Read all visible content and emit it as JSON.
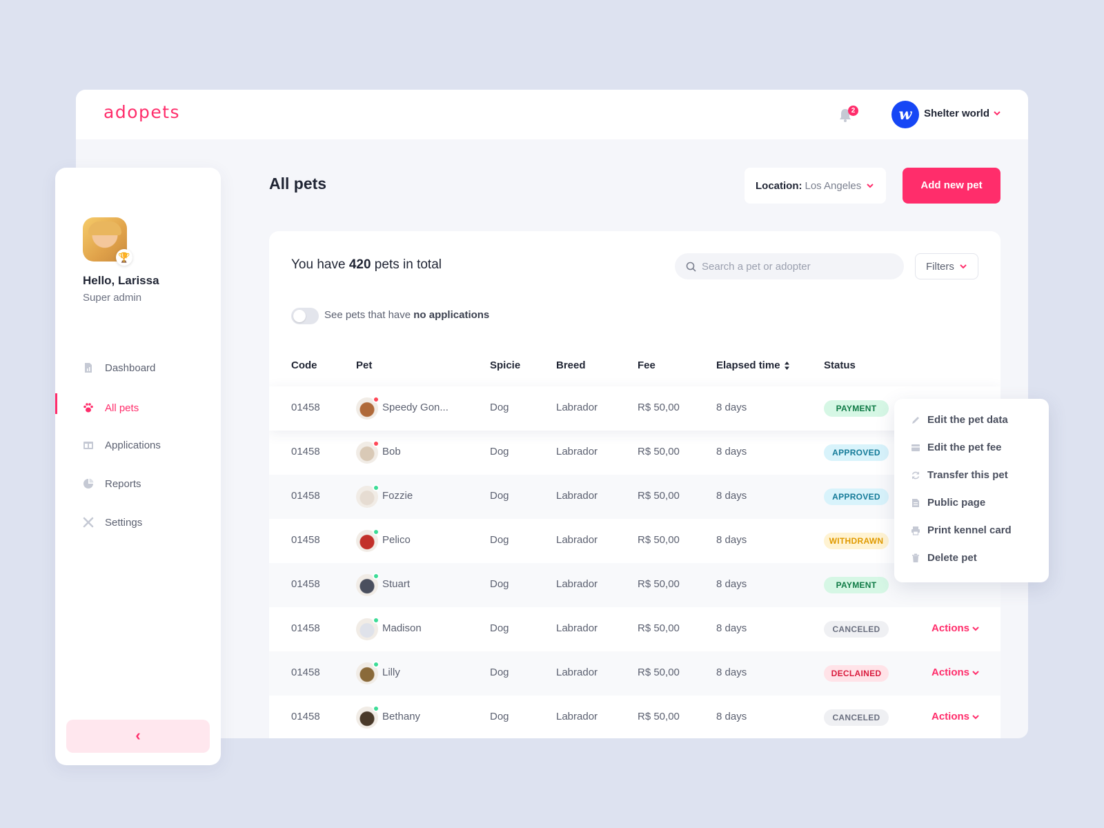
{
  "app": {
    "logo": "adopets",
    "accent": "#ff2d6b"
  },
  "header": {
    "notifications_count": "2",
    "org_avatar_letter": "w",
    "org_name": "Shelter world"
  },
  "sidebar": {
    "greeting": "Hello, Larissa",
    "role": "Super admin",
    "items": [
      {
        "label": "Dashboard",
        "icon": "document-chart-icon",
        "active": false
      },
      {
        "label": "All pets",
        "icon": "paw-icon",
        "active": true
      },
      {
        "label": "Applications",
        "icon": "columns-icon",
        "active": false
      },
      {
        "label": "Reports",
        "icon": "pie-chart-icon",
        "active": false
      },
      {
        "label": "Settings",
        "icon": "tools-icon",
        "active": false
      }
    ],
    "collapse_glyph": "‹"
  },
  "page": {
    "title": "All pets",
    "location_label": "Location:",
    "location_value": "Los Angeles",
    "add_button": "Add new pet"
  },
  "card": {
    "total_prefix": "You have ",
    "total_count": "420",
    "total_suffix": " pets in total",
    "search_placeholder": "Search a pet or adopter",
    "filters_label": "Filters",
    "toggle_prefix": "See pets that have ",
    "toggle_bold": "no applications",
    "toggle_on": false
  },
  "table": {
    "headers": {
      "code": "Code",
      "pet": "Pet",
      "spicie": "Spicie",
      "breed": "Breed",
      "fee": "Fee",
      "elapsed": "Elapsed time",
      "status": "Status"
    },
    "actions_label": "Actions",
    "rows": [
      {
        "code": "01458",
        "pet": "Speedy Gon...",
        "spicie": "Dog",
        "breed": "Labrador",
        "fee": "R$ 50,00",
        "elapsed": "8 days",
        "status": "PAYMENT",
        "dot": "#ff4757"
      },
      {
        "code": "01458",
        "pet": "Bob",
        "spicie": "Dog",
        "breed": "Labrador",
        "fee": "R$ 50,00",
        "elapsed": "8 days",
        "status": "APPROVED",
        "dot": "#ff4757"
      },
      {
        "code": "01458",
        "pet": "Fozzie",
        "spicie": "Dog",
        "breed": "Labrador",
        "fee": "R$ 50,00",
        "elapsed": "8 days",
        "status": "APPROVED",
        "dot": "#3ddc97"
      },
      {
        "code": "01458",
        "pet": "Pelico",
        "spicie": "Dog",
        "breed": "Labrador",
        "fee": "R$ 50,00",
        "elapsed": "8 days",
        "status": "WITHDRAWN",
        "dot": "#3ddc97"
      },
      {
        "code": "01458",
        "pet": "Stuart",
        "spicie": "Dog",
        "breed": "Labrador",
        "fee": "R$ 50,00",
        "elapsed": "8 days",
        "status": "PAYMENT",
        "dot": "#3ddc97"
      },
      {
        "code": "01458",
        "pet": "Madison",
        "spicie": "Dog",
        "breed": "Labrador",
        "fee": "R$ 50,00",
        "elapsed": "8 days",
        "status": "CANCELED",
        "dot": "#3ddc97"
      },
      {
        "code": "01458",
        "pet": "Lilly",
        "spicie": "Dog",
        "breed": "Labrador",
        "fee": "R$ 50,00",
        "elapsed": "8 days",
        "status": "DECLAINED",
        "dot": "#3ddc97"
      },
      {
        "code": "01458",
        "pet": "Bethany",
        "spicie": "Dog",
        "breed": "Labrador",
        "fee": "R$ 50,00",
        "elapsed": "8 days",
        "status": "CANCELED",
        "dot": "#3ddc97"
      }
    ]
  },
  "status_colors": {
    "PAYMENT": {
      "bg": "#d6f7e5",
      "fg": "#0e7a45"
    },
    "APPROVED": {
      "bg": "#d8f3fb",
      "fg": "#137a98"
    },
    "WITHDRAWN": {
      "bg": "#fff3d2",
      "fg": "#e09a00"
    },
    "CANCELED": {
      "bg": "#eff0f3",
      "fg": "#6b7080"
    },
    "DECLAINED": {
      "bg": "#ffe3e8",
      "fg": "#d91c3e"
    }
  },
  "actions_menu": {
    "items": [
      {
        "label": "Edit the pet data",
        "icon": "pencil-icon"
      },
      {
        "label": "Edit the pet fee",
        "icon": "card-icon"
      },
      {
        "label": "Transfer this pet",
        "icon": "refresh-icon"
      },
      {
        "label": "Public page",
        "icon": "page-icon"
      },
      {
        "label": "Print kennel card",
        "icon": "printer-icon"
      },
      {
        "label": "Delete pet",
        "icon": "trash-icon"
      }
    ]
  }
}
